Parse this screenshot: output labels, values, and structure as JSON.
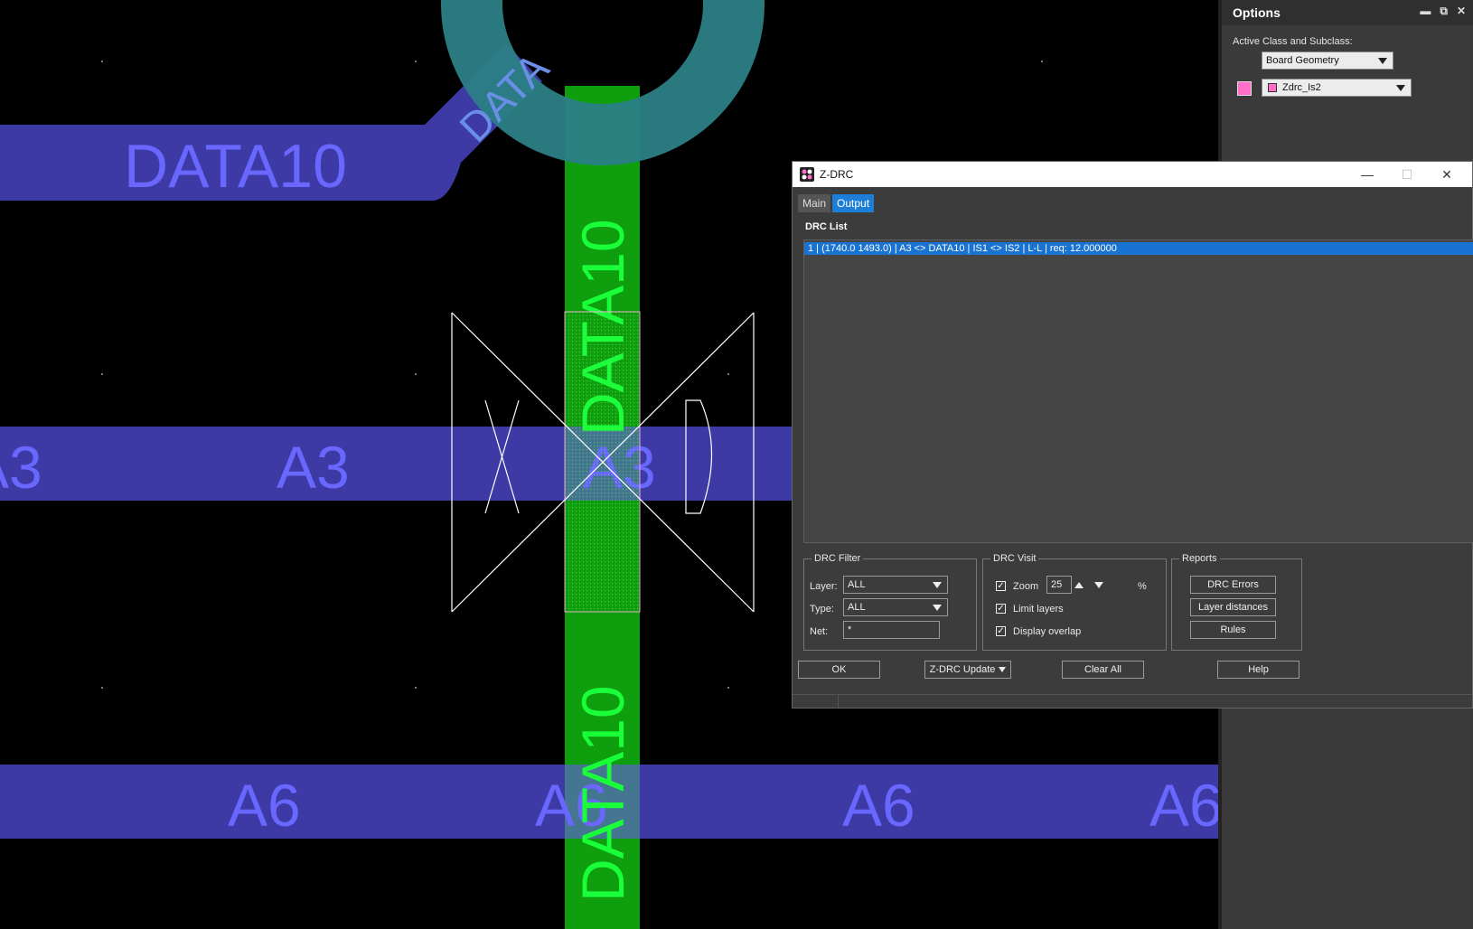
{
  "canvas": {
    "nets": {
      "data10_top": "DATA10",
      "data10_diag": "DATA",
      "data10_vertical": "DATA10",
      "a3": "A3",
      "a6": "A6"
    },
    "colors": {
      "blue_trace": "#3d3aa6",
      "blue_text": "#6a67ff",
      "green_trace": "#0e9e0e",
      "green_text": "#19ff3a",
      "pad_ring": "#2b7f86"
    }
  },
  "options": {
    "title": "Options",
    "active_label": "Active Class and Subclass:",
    "class_value": "Board Geometry",
    "subclass_value": "Zdrc_Is2",
    "subclass_color": "#ff6fc8"
  },
  "zdrc": {
    "title": "Z-DRC",
    "tabs": [
      "Main",
      "Output"
    ],
    "active_tab": "Output",
    "drc_list_label": "DRC List",
    "rows": [
      "1 | (1740.0 1493.0) | A3 <> DATA10 | IS1 <> IS2 | L-L | req: 12.000000"
    ],
    "filter": {
      "legend": "DRC Filter",
      "layer_label": "Layer:",
      "layer_value": "ALL",
      "type_label": "Type:",
      "type_value": "ALL",
      "net_label": "Net:",
      "net_value": "*"
    },
    "visit": {
      "legend": "DRC Visit",
      "zoom_label": "Zoom",
      "zoom_value": "25",
      "percent": "%",
      "limit_label": "Limit layers",
      "overlap_label": "Display overlap",
      "zoom_checked": true,
      "limit_checked": true,
      "overlap_checked": true
    },
    "reports": {
      "legend": "Reports",
      "drc_errors": "DRC Errors",
      "layer_distances": "Layer distances",
      "rules": "Rules"
    },
    "buttons": {
      "ok": "OK",
      "update": "Z-DRC Update",
      "clear_all": "Clear All",
      "help": "Help"
    }
  }
}
